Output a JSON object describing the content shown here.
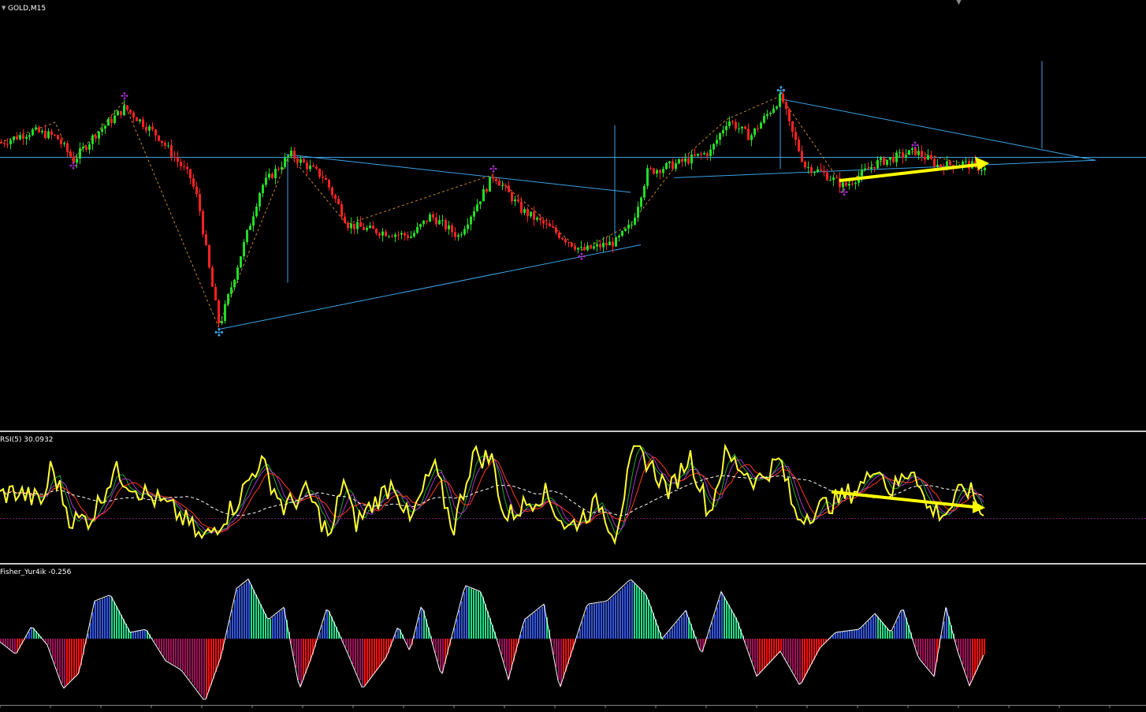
{
  "window": {
    "symbol_title": "GOLD,M15",
    "rsi_label": "RSI(5) 30.0932",
    "fisher_label": "Fisher_Yur4ik -0.256"
  },
  "colors": {
    "background": "#000000",
    "bull_candle": "#22dd22",
    "bear_candle": "#ff2222",
    "trendline": "#3aa3e6",
    "arrow": "#ffff00",
    "rsi_line": "#ffff33",
    "fisher_pos": "#3355dd",
    "fisher_pos_light": "#22dd88",
    "fisher_neg": "#a0105a",
    "fisher_neg_light": "#ff1010",
    "zigzag": "#c8862a",
    "fractal_mark": "#b030d0"
  },
  "chart_data": [
    {
      "type": "candlestick",
      "pane": "price",
      "title": "GOLD,M15",
      "x_range": [
        0,
        1330
      ],
      "y_range": [
        0,
        100
      ],
      "notes": "relative price levels; scale not printed in screenshot",
      "anchor_path": [
        [
          0,
          70
        ],
        [
          40,
          74
        ],
        [
          70,
          72
        ],
        [
          92,
          64
        ],
        [
          120,
          73
        ],
        [
          157,
          82
        ],
        [
          200,
          72
        ],
        [
          240,
          58
        ],
        [
          250,
          50
        ],
        [
          265,
          25
        ],
        [
          277,
          7
        ],
        [
          300,
          28
        ],
        [
          330,
          55
        ],
        [
          367,
          66
        ],
        [
          410,
          58
        ],
        [
          440,
          42
        ],
        [
          470,
          40
        ],
        [
          520,
          38
        ],
        [
          545,
          45
        ],
        [
          580,
          38
        ],
        [
          625,
          59
        ],
        [
          660,
          47
        ],
        [
          700,
          40
        ],
        [
          737,
          33
        ],
        [
          780,
          36
        ],
        [
          800,
          42
        ],
        [
          820,
          60
        ],
        [
          860,
          63
        ],
        [
          900,
          67
        ],
        [
          922,
          78
        ],
        [
          950,
          72
        ],
        [
          990,
          86
        ],
        [
          1000,
          76
        ],
        [
          1020,
          62
        ],
        [
          1040,
          60
        ],
        [
          1070,
          55
        ],
        [
          1110,
          63
        ],
        [
          1160,
          67
        ],
        [
          1190,
          62
        ],
        [
          1220,
          63
        ],
        [
          1248,
          61
        ]
      ],
      "zigzag_points": [
        [
          0,
          70
        ],
        [
          70,
          77
        ],
        [
          92,
          64
        ],
        [
          157,
          84
        ],
        [
          277,
          7
        ],
        [
          367,
          66
        ],
        [
          440,
          42
        ],
        [
          625,
          59
        ],
        [
          737,
          33
        ],
        [
          800,
          42
        ],
        [
          860,
          63
        ],
        [
          922,
          78
        ],
        [
          990,
          86
        ],
        [
          1070,
          55
        ],
        [
          1110,
          63
        ],
        [
          1160,
          67
        ],
        [
          1248,
          61
        ]
      ],
      "fractal_up": [
        [
          157,
          86
        ],
        [
          625,
          61
        ],
        [
          1160,
          69
        ]
      ],
      "fractal_down": [
        [
          92,
          62
        ],
        [
          737,
          31
        ],
        [
          1070,
          53
        ]
      ],
      "swing_markers": [
        [
          277,
          5
        ],
        [
          990,
          88
        ]
      ],
      "horizontal_line": 65,
      "triangles": [
        {
          "upper": [
            [
              363,
              66
            ],
            [
              800,
              53
            ]
          ],
          "lower": [
            [
              277,
              6
            ],
            [
              813,
              35
            ]
          ]
        },
        {
          "upper": [
            [
              990,
              85
            ],
            [
              1390,
              64
            ]
          ],
          "lower": [
            [
              855,
              58
            ],
            [
              1390,
              64
            ]
          ]
        }
      ],
      "vertical_lines": [
        [
          365,
          66,
          22
        ],
        [
          780,
          38,
          76
        ],
        [
          990,
          84,
          61
        ],
        [
          1322,
          98,
          68
        ]
      ],
      "arrow": [
        [
          1065,
          57
        ],
        [
          1255,
          63
        ]
      ]
    },
    {
      "type": "line",
      "pane": "rsi",
      "title": "RSI(5) 30.0932",
      "x_range": [
        0,
        1330
      ],
      "y_range": [
        0,
        100
      ],
      "last_value": 30.0932,
      "level": 30,
      "series": [
        {
          "name": "RSI(5)",
          "anchors": [
            [
              0,
              52
            ],
            [
              20,
              55
            ],
            [
              55,
              45
            ],
            [
              65,
              80
            ],
            [
              90,
              28
            ],
            [
              115,
              30
            ],
            [
              145,
              75
            ],
            [
              180,
              55
            ],
            [
              215,
              40
            ],
            [
              240,
              25
            ],
            [
              255,
              10
            ],
            [
              265,
              15
            ],
            [
              300,
              45
            ],
            [
              330,
              85
            ],
            [
              360,
              40
            ],
            [
              390,
              55
            ],
            [
              420,
              10
            ],
            [
              435,
              70
            ],
            [
              450,
              25
            ],
            [
              500,
              65
            ],
            [
              520,
              25
            ],
            [
              550,
              80
            ],
            [
              575,
              20
            ],
            [
              600,
              90
            ],
            [
              625,
              85
            ],
            [
              640,
              30
            ],
            [
              690,
              55
            ],
            [
              720,
              20
            ],
            [
              760,
              45
            ],
            [
              780,
              15
            ],
            [
              805,
              95
            ],
            [
              820,
              85
            ],
            [
              850,
              55
            ],
            [
              875,
              90
            ],
            [
              900,
              35
            ],
            [
              920,
              90
            ],
            [
              960,
              65
            ],
            [
              990,
              85
            ],
            [
              1010,
              30
            ],
            [
              1040,
              40
            ],
            [
              1070,
              50
            ],
            [
              1100,
              65
            ],
            [
              1110,
              85
            ],
            [
              1130,
              55
            ],
            [
              1160,
              80
            ],
            [
              1175,
              40
            ],
            [
              1200,
              35
            ],
            [
              1225,
              60
            ],
            [
              1240,
              45
            ],
            [
              1248,
              30
            ]
          ]
        }
      ],
      "arrow": [
        [
          1055,
          55
        ],
        [
          1250,
          40
        ]
      ]
    },
    {
      "type": "bar",
      "pane": "fisher",
      "title": "Fisher_Yur4ik -0.256",
      "x_range": [
        0,
        1250
      ],
      "y_range": [
        -1,
        1
      ],
      "last_value": -0.256,
      "anchors": [
        [
          0,
          -0.05
        ],
        [
          20,
          -0.25
        ],
        [
          40,
          0.2
        ],
        [
          60,
          -0.1
        ],
        [
          80,
          -0.8
        ],
        [
          100,
          -0.55
        ],
        [
          120,
          0.6
        ],
        [
          140,
          0.7
        ],
        [
          165,
          0.1
        ],
        [
          185,
          0.15
        ],
        [
          210,
          -0.35
        ],
        [
          230,
          -0.5
        ],
        [
          260,
          -1.0
        ],
        [
          280,
          -0.3
        ],
        [
          300,
          0.8
        ],
        [
          315,
          0.95
        ],
        [
          340,
          0.3
        ],
        [
          360,
          0.5
        ],
        [
          380,
          -0.8
        ],
        [
          395,
          -0.3
        ],
        [
          415,
          0.5
        ],
        [
          440,
          -0.2
        ],
        [
          460,
          -0.8
        ],
        [
          490,
          -0.3
        ],
        [
          505,
          0.2
        ],
        [
          520,
          -0.2
        ],
        [
          535,
          0.55
        ],
        [
          560,
          -0.6
        ],
        [
          590,
          0.85
        ],
        [
          610,
          0.75
        ],
        [
          630,
          0.0
        ],
        [
          645,
          -0.65
        ],
        [
          665,
          0.3
        ],
        [
          690,
          0.55
        ],
        [
          710,
          -0.8
        ],
        [
          745,
          0.55
        ],
        [
          770,
          0.6
        ],
        [
          800,
          0.95
        ],
        [
          820,
          0.7
        ],
        [
          840,
          0.0
        ],
        [
          870,
          0.45
        ],
        [
          890,
          -0.25
        ],
        [
          915,
          0.75
        ],
        [
          935,
          0.3
        ],
        [
          960,
          -0.6
        ],
        [
          990,
          -0.2
        ],
        [
          1015,
          -0.75
        ],
        [
          1040,
          -0.15
        ],
        [
          1060,
          0.1
        ],
        [
          1090,
          0.15
        ],
        [
          1110,
          0.4
        ],
        [
          1130,
          0.1
        ],
        [
          1145,
          0.5
        ],
        [
          1165,
          -0.3
        ],
        [
          1185,
          -0.6
        ],
        [
          1200,
          0.5
        ],
        [
          1215,
          -0.2
        ],
        [
          1230,
          -0.75
        ],
        [
          1248,
          -0.26
        ]
      ]
    }
  ]
}
